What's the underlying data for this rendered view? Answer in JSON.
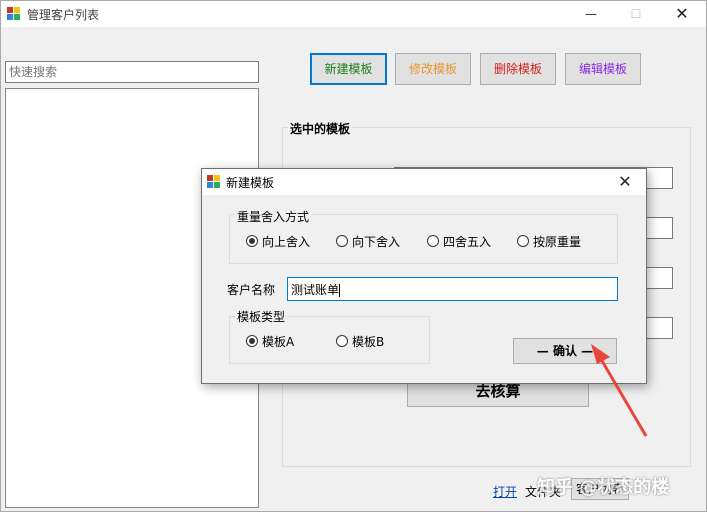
{
  "main_window": {
    "title": "管理客户列表",
    "caption_minimize": "—",
    "caption_maximize": "☐",
    "caption_close": "✕",
    "search_placeholder": "快速搜索",
    "buttons": {
      "new_template": "新建模板",
      "edit_template": "修改模板",
      "delete_template": "删除模板",
      "compose_template": "编辑模板"
    },
    "selected_group_label": "选中的模板",
    "go_check_button": "去核算",
    "footer": {
      "open_link": "打开",
      "file_label": "文件夹",
      "customer_list_button": "客户列表"
    }
  },
  "dialog": {
    "title": "新建模板",
    "close": "✕",
    "rounding_group_label": "重量舍入方式",
    "rounding_options": [
      "向上舍入",
      "向下舍入",
      "四舍五入",
      "按原重量"
    ],
    "rounding_selected_index": 0,
    "customer_name_label": "客户名称",
    "customer_name_value": "测试账单",
    "template_type_group_label": "模板类型",
    "template_type_options": [
      "模板A",
      "模板B"
    ],
    "template_type_selected_index": 0,
    "confirm_button": "确认"
  },
  "watermark": "知乎 @状态的楼",
  "colors": {
    "new_template": "#1a7f1a",
    "edit_template": "#e8952a",
    "delete_template": "#d61f1f",
    "compose_template": "#8a2be2",
    "arrow": "#e8453c"
  }
}
